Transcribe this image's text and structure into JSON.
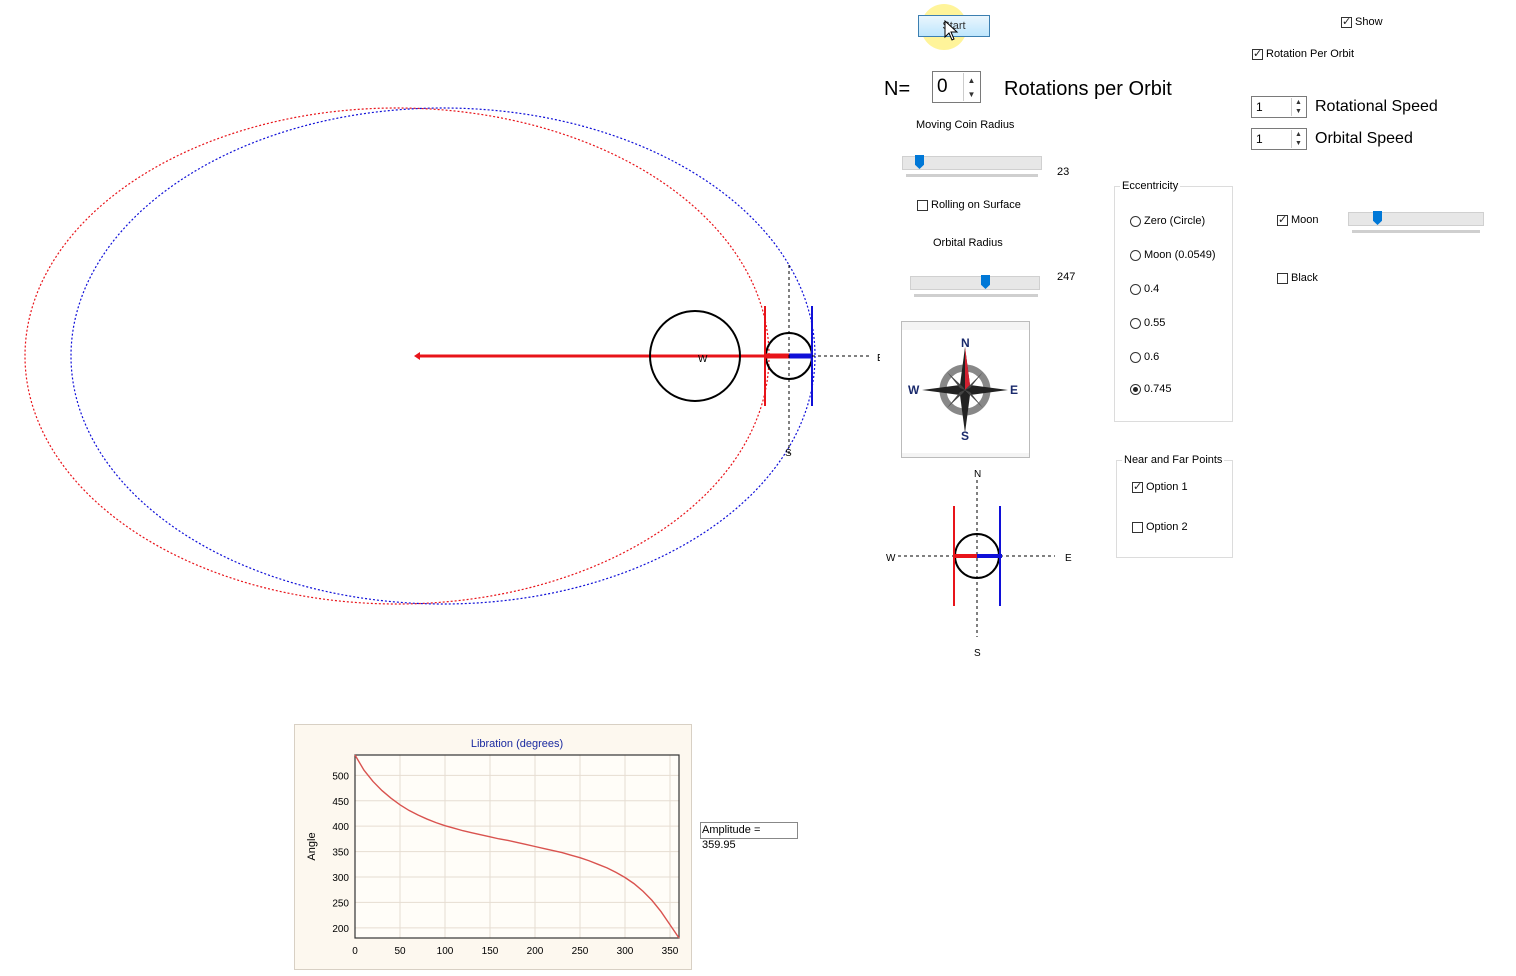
{
  "toolbar": {
    "start_label": "Start"
  },
  "options": {
    "show_label": "Show",
    "show_checked": true,
    "rotation_per_orbit_label": "Rotation Per Orbit",
    "rotation_per_orbit_checked": true
  },
  "rotations": {
    "n_label": "N=",
    "n_value": "0",
    "title": "Rotations per Orbit"
  },
  "speeds": {
    "rotational_value": "1",
    "rotational_label": "Rotational Speed",
    "orbital_value": "1",
    "orbital_label": "Orbital Speed"
  },
  "moving_coin": {
    "label": "Moving Coin Radius",
    "value": "23",
    "fraction": 0.1
  },
  "rolling": {
    "label": "Rolling on Surface",
    "checked": false
  },
  "orbital_radius": {
    "label": "Orbital Radius",
    "value": "247",
    "fraction": 0.6
  },
  "eccentricity": {
    "title": "Eccentricity",
    "options": [
      "Zero (Circle)",
      "Moon (0.0549)",
      "0.4",
      "0.55",
      "0.6",
      "0.745"
    ],
    "selected_index": 5
  },
  "near_far": {
    "title": "Near and Far Points",
    "option1": "Option 1",
    "option1_checked": true,
    "option2": "Option 2",
    "option2_checked": false
  },
  "moon": {
    "label": "Moon",
    "checked": true,
    "slider_fraction": 0.2
  },
  "black": {
    "label": "Black",
    "checked": false
  },
  "compass": {
    "n": "N",
    "s": "S",
    "e": "E",
    "w": "W"
  },
  "small_view": {
    "n": "N",
    "s": "S",
    "e": "E",
    "w": "W"
  },
  "orbit_view": {
    "e": "E",
    "w": "W",
    "s": "S"
  },
  "amplitude_label": "Amplitude = 359.95",
  "colors": {
    "red": "#e8141a",
    "blue": "#1010d8",
    "chart_line": "#d9534f",
    "accent": "#0078d7"
  },
  "chart_data": {
    "type": "line",
    "title": "Libration (degrees)",
    "xlabel": "",
    "ylabel": "Angle",
    "xlim": [
      0,
      360
    ],
    "ylim": [
      180,
      540
    ],
    "xticks": [
      0,
      50,
      100,
      150,
      200,
      250,
      300,
      350
    ],
    "yticks": [
      200,
      250,
      300,
      350,
      400,
      450,
      500
    ],
    "grid": true,
    "series": [
      {
        "x": [
          0,
          10,
          20,
          30,
          40,
          50,
          60,
          70,
          80,
          90,
          100,
          110,
          120,
          130,
          140,
          150,
          160,
          170,
          180,
          190,
          200,
          210,
          220,
          230,
          240,
          250,
          260,
          270,
          280,
          290,
          300,
          310,
          320,
          330,
          340,
          350,
          360
        ],
        "values": [
          540,
          510,
          488,
          470,
          455,
          442,
          431,
          422,
          414,
          407,
          401,
          396,
          391,
          387,
          383,
          379,
          375,
          372,
          368,
          364,
          360,
          356,
          352,
          348,
          343,
          338,
          332,
          325,
          318,
          309,
          299,
          287,
          272,
          254,
          232,
          206,
          180
        ]
      }
    ]
  }
}
